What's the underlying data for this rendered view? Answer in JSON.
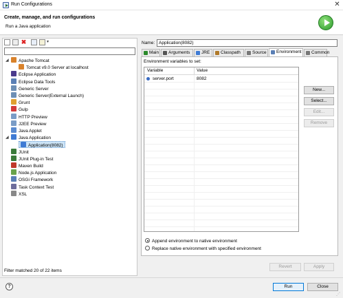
{
  "window": {
    "title": "Run Configurations",
    "close_glyph": "✕"
  },
  "header": {
    "title": "Create, manage, and run configurations",
    "subtitle": "Run a Java application"
  },
  "toolbar": {
    "icons": [
      "new-config-icon",
      "duplicate-icon",
      "delete-icon",
      "collapse-all-icon",
      "filter-icon"
    ],
    "delete_glyph": "✖",
    "dropdown_glyph": "▾"
  },
  "filter": {
    "value": "",
    "status": "Filter matched 20 of 22 items"
  },
  "tree": {
    "expanded_glyph": "◢",
    "items": [
      {
        "label": "Apache Tomcat",
        "level": 0,
        "expander": true,
        "icon_color": "#d9822b"
      },
      {
        "label": "Tomcat v9.0 Server at localhost",
        "level": 1,
        "expander": false,
        "icon_color": "#d9822b"
      },
      {
        "label": "Eclipse Application",
        "level": 0,
        "expander": false,
        "icon_color": "#4a3a8c"
      },
      {
        "label": "Eclipse Data Tools",
        "level": 0,
        "expander": false,
        "icon_color": "#5a7fb5"
      },
      {
        "label": "Generic Server",
        "level": 0,
        "expander": false,
        "icon_color": "#6d8fb5"
      },
      {
        "label": "Generic Server(External Launch)",
        "level": 0,
        "expander": false,
        "icon_color": "#6d8fb5"
      },
      {
        "label": "Grunt",
        "level": 0,
        "expander": false,
        "icon_color": "#e0a030"
      },
      {
        "label": "Gulp",
        "level": 0,
        "expander": false,
        "icon_color": "#d33a3a"
      },
      {
        "label": "HTTP Preview",
        "level": 0,
        "expander": false,
        "icon_color": "#7a9cc6"
      },
      {
        "label": "J2EE Preview",
        "level": 0,
        "expander": false,
        "icon_color": "#7a9cc6"
      },
      {
        "label": "Java Applet",
        "level": 0,
        "expander": false,
        "icon_color": "#5a8bd0"
      },
      {
        "label": "Java Application",
        "level": 0,
        "expander": true,
        "icon_color": "#3f7bd4"
      },
      {
        "label": "Application(8082)",
        "level": 1,
        "expander": false,
        "icon_color": "#3f7bd4",
        "selected": true
      },
      {
        "label": "JUnit",
        "level": 0,
        "expander": false,
        "icon_color": "#3a7a3a"
      },
      {
        "label": "JUnit Plug-in Test",
        "level": 0,
        "expander": false,
        "icon_color": "#3a7a3a"
      },
      {
        "label": "Maven Build",
        "level": 0,
        "expander": false,
        "icon_color": "#c0392b"
      },
      {
        "label": "Node.js Application",
        "level": 0,
        "expander": false,
        "icon_color": "#6aa34a"
      },
      {
        "label": "OSGi Framework",
        "level": 0,
        "expander": false,
        "icon_color": "#5a7fb5"
      },
      {
        "label": "Task Context Test",
        "level": 0,
        "expander": false,
        "icon_color": "#6d6d9c"
      },
      {
        "label": "XSL",
        "level": 0,
        "expander": false,
        "icon_color": "#888888"
      }
    ]
  },
  "config": {
    "name_label": "Name:",
    "name_value": "Application(8082)",
    "tabs": [
      {
        "label": "Main",
        "icon_color": "#2c8a2c"
      },
      {
        "label": "Arguments",
        "icon_color": "#555555"
      },
      {
        "label": "JRE",
        "icon_color": "#3f7bd4"
      },
      {
        "label": "Classpath",
        "icon_color": "#b07a2a"
      },
      {
        "label": "Source",
        "icon_color": "#777777"
      },
      {
        "label": "Environment",
        "icon_color": "#5a7fb5",
        "active": true
      },
      {
        "label": "Common",
        "icon_color": "#777777"
      }
    ]
  },
  "environment": {
    "label": "Environment variables to set:",
    "columns": [
      "Variable",
      "Value"
    ],
    "rows": [
      {
        "variable": "server.port",
        "value": "8082"
      }
    ],
    "buttons": {
      "new": "New...",
      "select": "Select...",
      "edit": "Edit...",
      "remove": "Remove"
    },
    "radio_append": "Append environment to native environment",
    "radio_replace": "Replace native environment with specified environment"
  },
  "footer_buttons": {
    "revert": "Revert",
    "apply": "Apply",
    "run": "Run",
    "close": "Close"
  },
  "help_glyph": "?",
  "grip_glyph": "⋰"
}
